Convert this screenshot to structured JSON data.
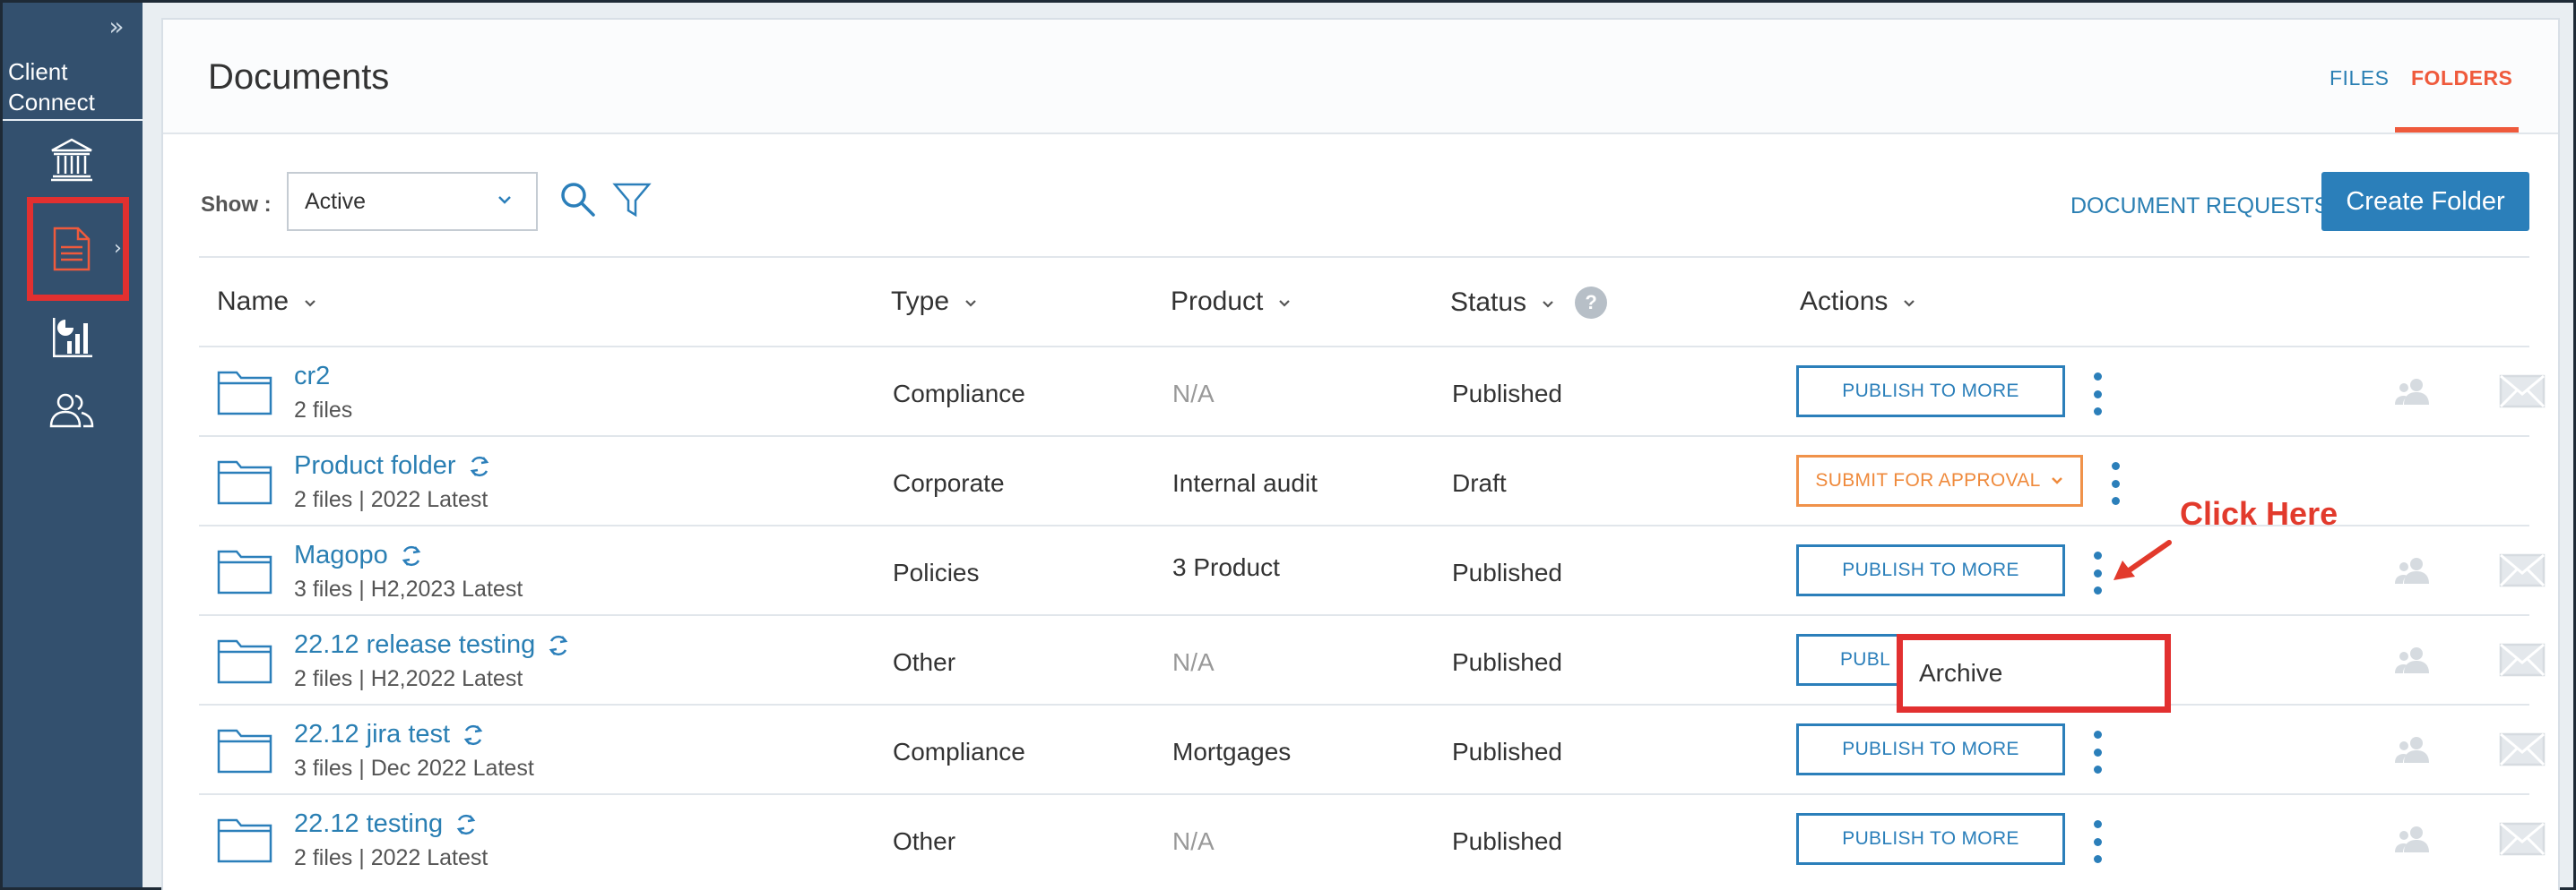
{
  "sidebar": {
    "brand_line1": "Client",
    "brand_line2": "Connect",
    "items": [
      {
        "icon": "bank-icon"
      },
      {
        "icon": "document-icon",
        "active": true
      },
      {
        "icon": "report-chart-icon"
      },
      {
        "icon": "users-icon"
      }
    ]
  },
  "header": {
    "title": "Documents",
    "tabs": [
      {
        "label": "FILES",
        "active": false
      },
      {
        "label": "FOLDERS",
        "active": true
      }
    ]
  },
  "toolbar": {
    "show_label": "Show :",
    "show_value": "Active",
    "document_requests": "DOCUMENT REQUESTS",
    "create_folder": "Create Folder"
  },
  "table": {
    "headers": {
      "name": "Name",
      "type": "Type",
      "product": "Product",
      "status": "Status",
      "status_help": "?",
      "actions": "Actions"
    },
    "rows": [
      {
        "name": "cr2",
        "meta": "2 files",
        "synced": false,
        "type": "Compliance",
        "product": "N/A",
        "status": "Published",
        "action": "PUBLISH TO MORE"
      },
      {
        "name": "Product folder",
        "meta": "2 files | 2022 Latest",
        "synced": true,
        "type": "Corporate",
        "product": "Internal audit",
        "status": "Draft",
        "action": "SUBMIT FOR APPROVAL"
      },
      {
        "name": "Magopo",
        "meta": "3 files | H2,2023 Latest",
        "synced": true,
        "type": "Policies",
        "product": "3 Product",
        "status": "Published",
        "action": "PUBLISH TO MORE"
      },
      {
        "name": "22.12 release testing",
        "meta": "2 files | H2,2022 Latest",
        "synced": true,
        "type": "Other",
        "product": "N/A",
        "status": "Published",
        "action": "PUBL"
      },
      {
        "name": "22.12 jira test",
        "meta": "3 files | Dec 2022 Latest",
        "synced": true,
        "type": "Compliance",
        "product": "Mortgages",
        "status": "Published",
        "action": "PUBLISH TO MORE"
      },
      {
        "name": "22.12 testing",
        "meta": "2 files | 2022 Latest",
        "synced": true,
        "type": "Other",
        "product": "N/A",
        "status": "Published",
        "action": "PUBLISH TO MORE"
      }
    ]
  },
  "annotation": {
    "click_here": "Click Here",
    "menu_item": "Archive",
    "highlight_color": "#e23030"
  },
  "colors": {
    "sidebar_bg": "#33506e",
    "primary": "#2b7fba",
    "accent": "#ef5a3c",
    "approval": "#ef8a3c"
  }
}
